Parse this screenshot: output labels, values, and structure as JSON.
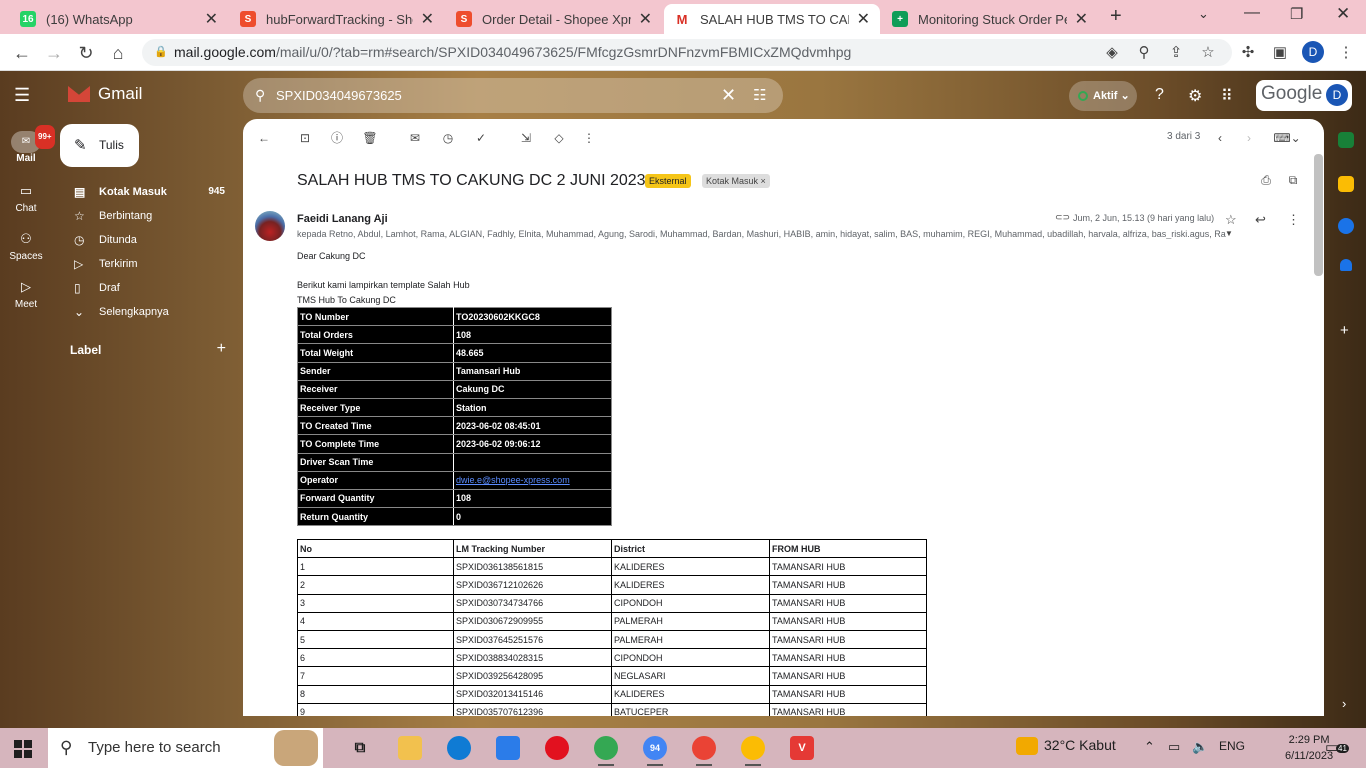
{
  "browser": {
    "tabs": [
      {
        "title": "(16) WhatsApp",
        "favicon": "whatsapp-icon",
        "color": "#25d366",
        "badge": "16"
      },
      {
        "title": "hubForwardTracking - Shope",
        "favicon": "shopee-icon",
        "color": "#ee4d2d",
        "badge": "S"
      },
      {
        "title": "Order Detail - Shopee Xpress",
        "favicon": "shopee-icon",
        "color": "#ee4d2d",
        "badge": "S"
      },
      {
        "title": "SALAH HUB TMS TO CAKUNG",
        "favicon": "gmail-icon",
        "color": "#d93025",
        "badge": "M"
      },
      {
        "title": "Monitoring Stuck Order Pend",
        "favicon": "sheets-icon",
        "color": "#0f9d58",
        "badge": "+"
      }
    ],
    "url_host": "mail.google.com",
    "url_rest": "/mail/u/0/?tab=rm#search/SPXID034049673625/FMfcgzGsmrDNFnzvmFBMICxZMQdvmhpg",
    "profile_initial": "D"
  },
  "gmail": {
    "product": "Gmail",
    "search_value": "SPXID034049673625",
    "status": "Aktif",
    "google_word": "Google",
    "profile_initial": "D",
    "rail": [
      {
        "label": "Mail",
        "badge": "99+"
      },
      {
        "label": "Chat"
      },
      {
        "label": "Spaces"
      },
      {
        "label": "Meet"
      }
    ],
    "compose": "Tulis",
    "nav": [
      {
        "label": "Kotak Masuk",
        "count": "945"
      },
      {
        "label": "Berbintang"
      },
      {
        "label": "Ditunda"
      },
      {
        "label": "Terkirim"
      },
      {
        "label": "Draf"
      },
      {
        "label": "Selengkapnya"
      }
    ],
    "label_header": "Label",
    "pager": "3 dari 3"
  },
  "email": {
    "subject": "SALAH HUB TMS TO CAKUNG DC 2 JUNI 2023",
    "chip_external": "Eksternal",
    "chip_inbox": "Kotak Masuk ×",
    "sender": "Faeidi Lanang Aji",
    "recipients": "kepada Retno, Abdul, Lamhot, Rama, ALGIAN, Fadhly, Elnita, Muhammad, Agung, Sarodi, Muhammad, Bardan, Mashuri, HABIB, amin, hidayat, salim, BAS, muhamim, REGI, Muhammad, ubadillah, harvala, alfriza, bas_riski.agus, Ra",
    "date": "Jum, 2 Jun, 15.13 (9 hari yang lalu)",
    "greeting": "Dear Cakung DC",
    "line1": "Berikut kami lampirkan template Salah Hub",
    "line2": "TMS Hub To Cakung DC",
    "summary": [
      {
        "k": "TO Number",
        "v": "TO20230602KKGC8"
      },
      {
        "k": "Total Orders",
        "v": "108"
      },
      {
        "k": "Total Weight",
        "v": "48.665"
      },
      {
        "k": "Sender",
        "v": "Tamansari Hub"
      },
      {
        "k": "Receiver",
        "v": "Cakung DC"
      },
      {
        "k": "Receiver Type",
        "v": "Station"
      },
      {
        "k": "TO Created Time",
        "v": "2023-06-02 08:45:01"
      },
      {
        "k": "TO Complete Time",
        "v": "2023-06-02 09:06:12"
      },
      {
        "k": "Driver Scan Time",
        "v": ""
      },
      {
        "k": "Operator",
        "v": "dwie.e@shopee-xpress.com",
        "link": true
      },
      {
        "k": "Forward Quantity",
        "v": "108"
      },
      {
        "k": "Return Quantity",
        "v": "0"
      }
    ],
    "detail_headers": [
      "No",
      "LM Tracking Number",
      "District",
      "FROM HUB"
    ],
    "detail_rows": [
      [
        "1",
        "SPXID036138561815",
        "KALIDERES",
        "TAMANSARI HUB"
      ],
      [
        "2",
        "SPXID036712102626",
        "KALIDERES",
        "TAMANSARI HUB"
      ],
      [
        "3",
        "SPXID030734734766",
        "CIPONDOH",
        "TAMANSARI HUB"
      ],
      [
        "4",
        "SPXID030672909955",
        "PALMERAH",
        "TAMANSARI HUB"
      ],
      [
        "5",
        "SPXID037645251576",
        "PALMERAH",
        "TAMANSARI HUB"
      ],
      [
        "6",
        "SPXID038834028315",
        "CIPONDOH",
        "TAMANSARI HUB"
      ],
      [
        "7",
        "SPXID039256428095",
        "NEGLASARI",
        "TAMANSARI HUB"
      ],
      [
        "8",
        "SPXID032013415146",
        "KALIDERES",
        "TAMANSARI HUB"
      ],
      [
        "9",
        "SPXID035707612396",
        "BATUCEPER",
        "TAMANSARI HUB"
      ]
    ]
  },
  "taskbar": {
    "search_placeholder": "Type here to search",
    "weather": "32°C  Kabut",
    "lang": "ENG",
    "time": "2:29 PM",
    "date": "6/11/2023",
    "notifications": "41",
    "chrome_badge": "94"
  }
}
